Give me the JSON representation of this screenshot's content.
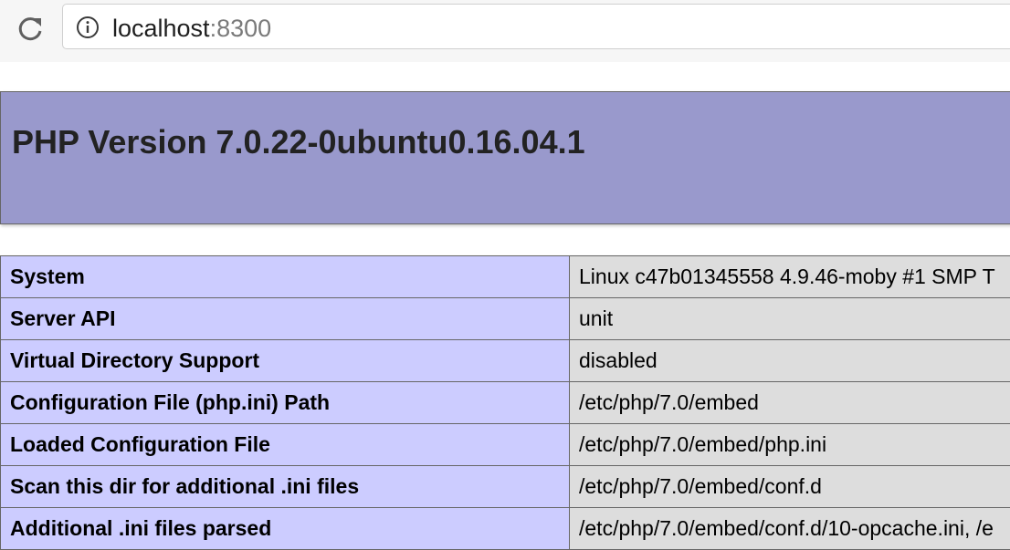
{
  "browser": {
    "address_host": "localhost",
    "address_port": ":8300",
    "icons": {
      "reload": "reload-icon",
      "site_info": "info-icon"
    }
  },
  "php": {
    "title": "PHP Version 7.0.22-0ubuntu0.16.04.1",
    "colors": {
      "header": "#9999cc",
      "label_cell": "#ccccff",
      "value_cell": "#dddddd",
      "border": "#666666"
    },
    "rows": [
      {
        "label": "System",
        "value": "Linux c47b01345558 4.9.46-moby #1 SMP T"
      },
      {
        "label": "Server API",
        "value": "unit"
      },
      {
        "label": "Virtual Directory Support",
        "value": "disabled"
      },
      {
        "label": "Configuration File (php.ini) Path",
        "value": "/etc/php/7.0/embed"
      },
      {
        "label": "Loaded Configuration File",
        "value": "/etc/php/7.0/embed/php.ini"
      },
      {
        "label": "Scan this dir for additional .ini files",
        "value": "/etc/php/7.0/embed/conf.d"
      },
      {
        "label": "Additional .ini files parsed",
        "value": "/etc/php/7.0/embed/conf.d/10-opcache.ini, /e"
      }
    ]
  }
}
